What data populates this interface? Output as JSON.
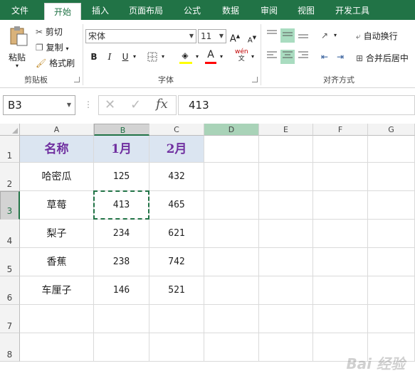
{
  "tabs": [
    "文件",
    "开始",
    "插入",
    "页面布局",
    "公式",
    "数据",
    "审阅",
    "视图",
    "开发工具"
  ],
  "clipboard": {
    "paste": "粘贴",
    "cut": "剪切",
    "copy": "复制",
    "format_painter": "格式刷",
    "label": "剪贴板"
  },
  "font": {
    "name": "宋体",
    "size": "11",
    "bold": "B",
    "italic": "I",
    "underline": "U",
    "grow": "A",
    "shrink": "A",
    "phonetic": "wén",
    "phonetic_sub": "文",
    "label": "字体",
    "fill_color": "#ffff00",
    "font_color": "#ff0000"
  },
  "alignment": {
    "wrap_text": "自动换行",
    "merge_center": "合并后居中",
    "label": "对齐方式"
  },
  "formula_bar": {
    "name_box": "B3",
    "fx": "fx",
    "content": "413"
  },
  "sheet": {
    "columns": [
      "A",
      "B",
      "C",
      "D",
      "E",
      "F",
      "G"
    ],
    "rows": [
      "1",
      "2",
      "3",
      "4",
      "5",
      "6",
      "7",
      "8"
    ],
    "header": [
      "名称",
      "1月",
      "2月"
    ],
    "data": [
      [
        "哈密瓜",
        "125",
        "432"
      ],
      [
        "草莓",
        "413",
        "465"
      ],
      [
        "梨子",
        "234",
        "621"
      ],
      [
        "香蕉",
        "238",
        "742"
      ],
      [
        "车厘子",
        "146",
        "521"
      ]
    ],
    "selected_cell": "B3",
    "accent_color": "#217346",
    "header_fill": "#dbe5f1",
    "header_text_color": "#7030a0"
  },
  "watermark": "Bai 经验"
}
